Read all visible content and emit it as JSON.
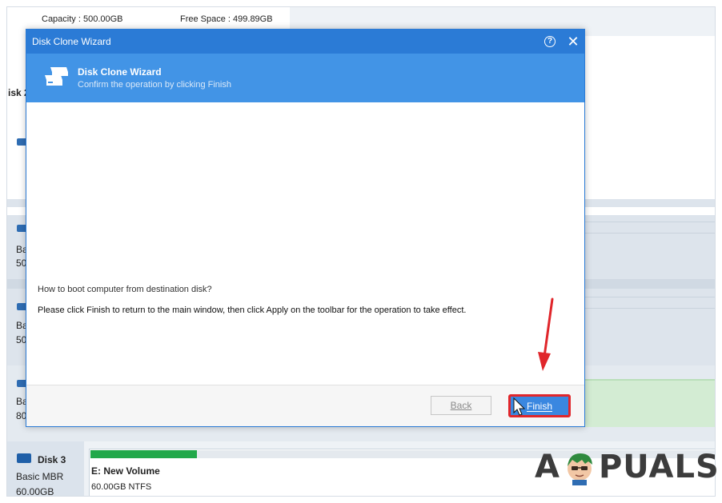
{
  "background_app": {
    "capacity_text": "Capacity : 500.00GB",
    "free_space_text": "Free Space : 499.89GB",
    "left_labels": [
      "isk 2",
      "Ba",
      "50",
      "Ba",
      "50",
      "Ba",
      "80"
    ],
    "disk3": {
      "name": "Disk 3",
      "type": "Basic MBR",
      "size": "60.00GB",
      "volume_label": "E: New Volume",
      "volume_detail": "60.00GB NTFS",
      "used_fraction": 0.17
    }
  },
  "dialog": {
    "window_title": "Disk Clone Wizard",
    "header_title": "Disk Clone Wizard",
    "header_subtitle": "Confirm the operation by clicking Finish",
    "question": "How to boot computer from destination disk?",
    "instruction": "Please click Finish to return to the main window, then click Apply on the toolbar for the operation to take effect.",
    "back_label": "Back",
    "finish_label": "Finish",
    "icons": {
      "help": "help-icon",
      "close": "close-icon",
      "header": "disk-clone-icon"
    }
  },
  "watermark": {
    "a": "A",
    "rest": "PUALS"
  },
  "colors": {
    "accent": "#2b7bd6",
    "header": "#4294e6",
    "highlight": "#e0262b",
    "progress": "#22a84a"
  }
}
